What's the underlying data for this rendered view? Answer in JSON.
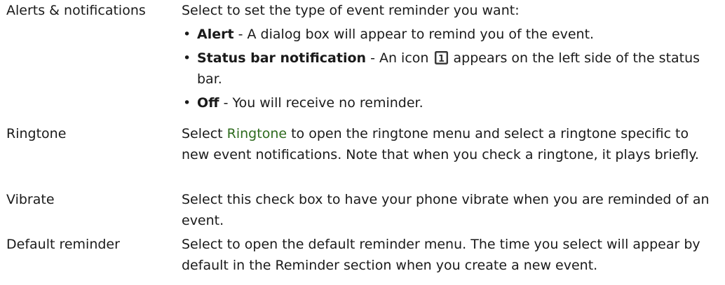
{
  "rows": [
    {
      "term": "Alerts & notifications",
      "intro": "Select to set the type of event reminder you want:",
      "bullets": [
        {
          "label": "Alert",
          "text": " - A dialog box will appear to remind you of the event."
        },
        {
          "label": "Status bar notification",
          "text_before": " - An icon ",
          "text_after": " appears on the left side of the status bar.",
          "icon": "calendar-day-icon",
          "icon_digit": "1"
        },
        {
          "label": "Off",
          "text": " - You will receive no reminder."
        }
      ]
    },
    {
      "term": "Ringtone",
      "before": "Select ",
      "link": "Ringtone",
      "after": " to open the ringtone menu and select a ringtone specific to new event notifications. Note that when you check a ringtone, it plays briefly."
    },
    {
      "term": "Vibrate",
      "text": "Select this check box to have your phone vibrate when you are reminded of an event."
    },
    {
      "term": "Default reminder",
      "text": "Select to open the default reminder menu. The time you select will appear by default in the Reminder section when you create a new event."
    }
  ],
  "bullet_char": "•",
  "colors": {
    "text": "#1a1a1a",
    "link": "#2e6b1e",
    "icon_bg": "#4a4a4a"
  }
}
